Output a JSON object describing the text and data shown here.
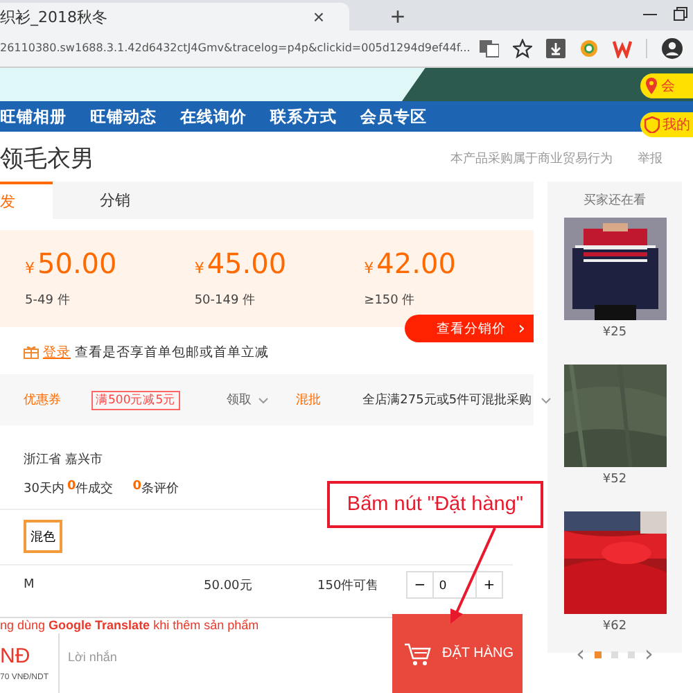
{
  "browser": {
    "tab_title": "织衫_2018秋冬",
    "tab_close": "×",
    "new_tab": "+",
    "url": "26110380.sw1688.3.1.42d6432ctJ4Gmv&tracelog=p4p&clickid=005d1294d9ef44f..."
  },
  "header": {
    "badges": [
      {
        "kind": "pin",
        "label": "会"
      },
      {
        "kind": "shield",
        "label": "我的"
      }
    ]
  },
  "nav": [
    "旺铺相册",
    "旺铺动态",
    "在线询价",
    "联系方式",
    "会员专区"
  ],
  "product": {
    "title": "领毛衣男",
    "notice": "本产品采购属于商业贸易行为",
    "report": "举报"
  },
  "tabs": [
    {
      "label": "发",
      "selected": true
    },
    {
      "label": "分销",
      "selected": false
    }
  ],
  "prices": [
    {
      "currency": "¥",
      "amount": "50.00",
      "range": "5-49 件"
    },
    {
      "currency": "¥",
      "amount": "45.00",
      "range": "50-149 件"
    },
    {
      "currency": "¥",
      "amount": "42.00",
      "range": "≥150 件"
    }
  ],
  "distribution_button": {
    "label": "查看分销价",
    "arrow": "›"
  },
  "login_hint": {
    "link": "登录",
    "text": "查看是否享首单包邮或首单立减"
  },
  "promotions": {
    "coupon_label": "优惠券",
    "coupon": "满500元减5元",
    "claim": "领取",
    "mix_label": "混批",
    "mix_text": "全店满275元或5件可混批采购"
  },
  "origin": {
    "location": "浙江省 嘉兴市",
    "sales_prefix": "30天内",
    "sales_count": "0",
    "sales_suffix": "件成交",
    "reviews_count": "0",
    "reviews_suffix": "条评价"
  },
  "colors": [
    {
      "label": "混色",
      "selected": true
    }
  ],
  "sku_row": {
    "size": "M",
    "price": "50.00元",
    "stock": "150件可售",
    "minus": "−",
    "quantity": "0",
    "plus": "+"
  },
  "sidebar": {
    "title": "买家还在看",
    "items": [
      {
        "kind": "picture",
        "price": "¥25"
      },
      {
        "kind": "picture",
        "price": "¥52"
      },
      {
        "kind": "picture",
        "price": "¥62"
      }
    ],
    "prev": "‹",
    "next": "›",
    "pages": [
      {
        "selected": true
      },
      {
        "selected": false
      },
      {
        "selected": false
      }
    ]
  },
  "order_bar": {
    "notice": "ng dùng **Google Translate** khi thêm sản phẩm",
    "total": "NĐ",
    "rate": "70 VNĐ/NDT",
    "message_placeholder": "Lời nhắn",
    "order_button": "ĐẶT HÀNG"
  },
  "annotation": {
    "text": "Bấm nút \"Đặt hàng\""
  }
}
